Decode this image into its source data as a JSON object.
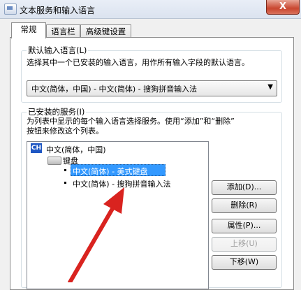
{
  "window": {
    "title": "文本服务和输入语言",
    "close_glyph": "X"
  },
  "tabs": [
    {
      "label": "常规",
      "active": true
    },
    {
      "label": "语言栏",
      "active": false
    },
    {
      "label": "高级键设置",
      "active": false
    }
  ],
  "default_language": {
    "legend": "默认输入语言(L)",
    "description": "选择其中一个已安装的输入语言，用作所有输入字段的默认语言。",
    "selected": "中文(简体，中国) - 中文(简体) - 搜狗拼音输入法"
  },
  "installed_services": {
    "legend": "已安装的服务(I)",
    "description_line1": "为列表中显示的每个输入语言选择服务。使用“添加”和“删除”",
    "description_line2": "按钮来修改这个列表。",
    "language_badge": "CH",
    "language": "中文(简体，中国)",
    "category": "键盘",
    "items": [
      {
        "label": "中文(简体) - 美式键盘",
        "selected": true
      },
      {
        "label": "中文(简体) - 搜狗拼音输入法",
        "selected": false
      }
    ]
  },
  "buttons": {
    "add": "添加(D)...",
    "remove": "删除(R)",
    "properties": "属性(P)...",
    "move_up": "上移(U)",
    "move_down": "下移(W)"
  },
  "colors": {
    "selection": "#3399ff",
    "arrow": "#d9231f",
    "badge": "#1f57c3"
  }
}
